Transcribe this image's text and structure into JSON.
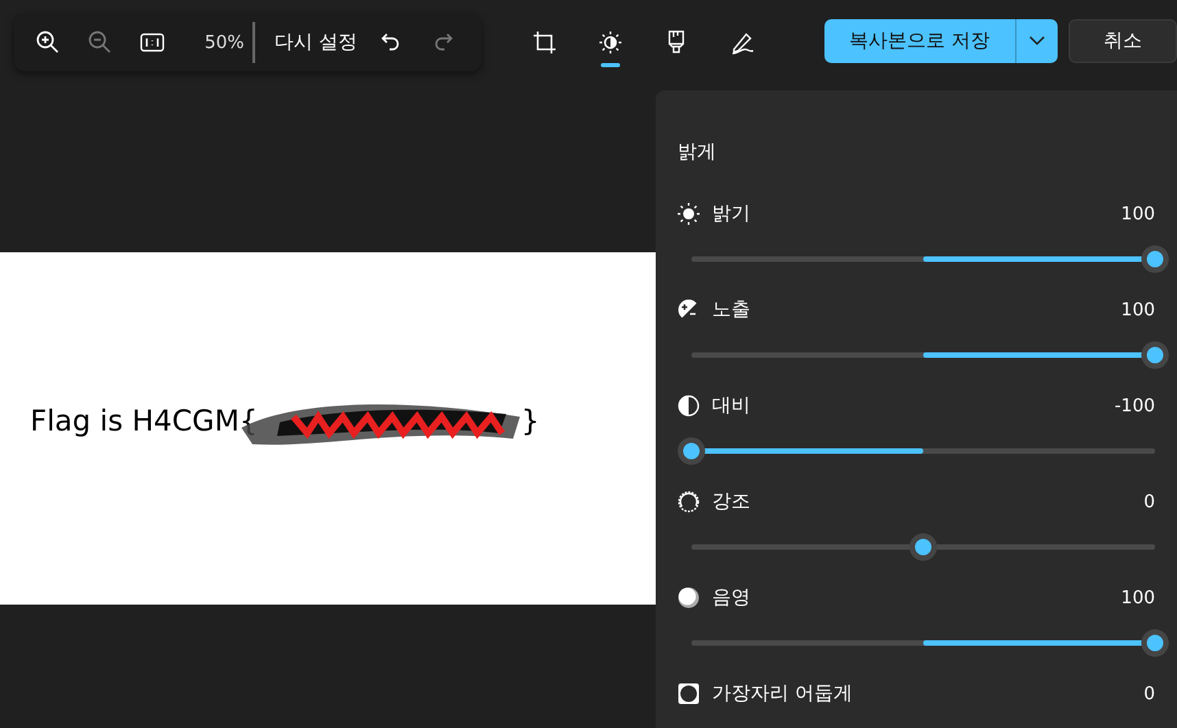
{
  "zoom_bar": {
    "zoom_level": "50%",
    "reset": "다시 설정"
  },
  "tools": [
    {
      "kind": "crop",
      "selected": false
    },
    {
      "kind": "adjust",
      "selected": true
    },
    {
      "kind": "filter",
      "selected": false
    },
    {
      "kind": "markup",
      "selected": false
    }
  ],
  "save_button": "복사본으로 저장",
  "cancel_button": "취소",
  "canvas": {
    "text": "Flag is H4CGM{",
    "closing": "}"
  },
  "panel": {
    "title": "밝게",
    "adjustments": [
      {
        "kind": "brightness",
        "label": "밝기",
        "reading": "100",
        "level": 1.0
      },
      {
        "kind": "exposure",
        "label": "노출",
        "reading": "100",
        "level": 1.0
      },
      {
        "kind": "contrast",
        "label": "대비",
        "reading": "-100",
        "level": 0.0
      },
      {
        "kind": "highlights",
        "label": "강조",
        "reading": "0",
        "level": 0.5
      },
      {
        "kind": "shadows",
        "label": "음영",
        "reading": "100",
        "level": 1.0
      },
      {
        "kind": "vignette",
        "label": "가장자리 어둡게",
        "reading": "0"
      }
    ]
  }
}
